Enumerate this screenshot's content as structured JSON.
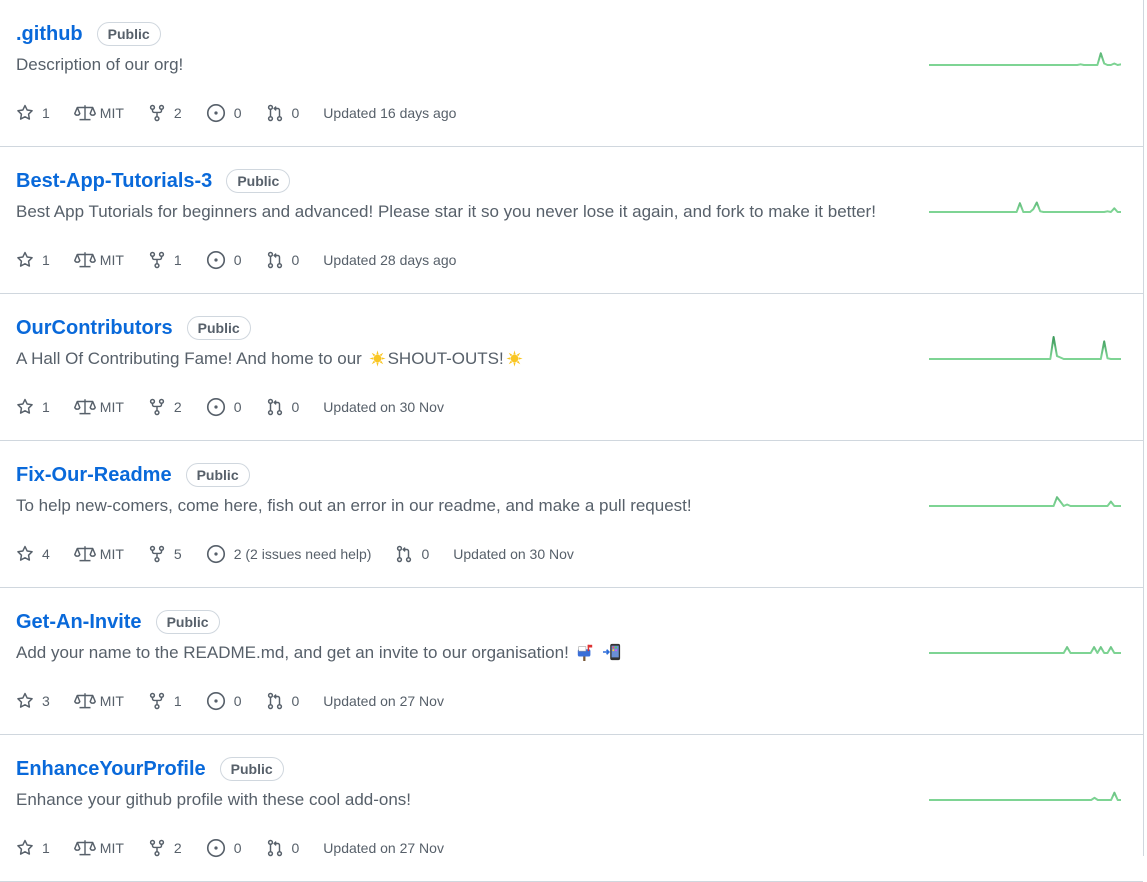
{
  "repos": [
    {
      "name": ".github",
      "visibility": "Public",
      "description": "Description of our org!",
      "stars": "1",
      "license": "MIT",
      "forks": "2",
      "issues": "0",
      "pulls": "0",
      "updated": "Updated 16 days ago",
      "activity": [
        0,
        0,
        0,
        0,
        0,
        0,
        0,
        0,
        0,
        0,
        0,
        0,
        0,
        0,
        0,
        0,
        0,
        0,
        0,
        0,
        0,
        0,
        0,
        0,
        0,
        0,
        0,
        0,
        0,
        0,
        0,
        0,
        0,
        0,
        0,
        0,
        0,
        0,
        0,
        0,
        0,
        0,
        0,
        0,
        0,
        1,
        0,
        0,
        0,
        0,
        0,
        16,
        2,
        0,
        0,
        2,
        0,
        1
      ]
    },
    {
      "name": "Best-App-Tutorials-3",
      "visibility": "Public",
      "description": "Best App Tutorials for beginners and advanced! Please star it so you never lose it again, and fork to make it better!",
      "stars": "1",
      "license": "MIT",
      "forks": "1",
      "issues": "0",
      "pulls": "0",
      "updated": "Updated 28 days ago",
      "activity": [
        0,
        0,
        0,
        0,
        0,
        0,
        0,
        0,
        0,
        0,
        0,
        0,
        0,
        0,
        0,
        0,
        0,
        0,
        0,
        0,
        0,
        0,
        0,
        0,
        0,
        0,
        0,
        12,
        0,
        0,
        0,
        4,
        13,
        1,
        0,
        0,
        0,
        0,
        0,
        0,
        0,
        0,
        0,
        0,
        0,
        0,
        0,
        0,
        0,
        0,
        0,
        0,
        0,
        1,
        0,
        5,
        0,
        0
      ]
    },
    {
      "name": "OurContributors",
      "visibility": "Public",
      "description": "A Hall Of Contributing Fame! And home to our 🌟SHOUT-OUTS!🌟",
      "stars": "1",
      "license": "MIT",
      "forks": "2",
      "issues": "0",
      "pulls": "0",
      "updated": "Updated on 30 Nov",
      "activity": [
        0,
        0,
        0,
        0,
        0,
        0,
        0,
        0,
        0,
        0,
        0,
        0,
        0,
        0,
        0,
        0,
        0,
        0,
        0,
        0,
        0,
        0,
        0,
        0,
        0,
        0,
        0,
        0,
        0,
        0,
        0,
        0,
        0,
        0,
        0,
        0,
        0,
        30,
        4,
        2,
        0,
        0,
        0,
        0,
        0,
        0,
        0,
        0,
        0,
        0,
        0,
        0,
        24,
        1,
        0,
        0,
        0,
        0
      ]
    },
    {
      "name": "Fix-Our-Readme",
      "visibility": "Public",
      "description": "To help new-comers, come here, fish out an error in our readme, and make a pull request!",
      "stars": "4",
      "license": "MIT",
      "forks": "5",
      "issues": "2 (2 issues need help)",
      "pulls": "0",
      "updated": "Updated on 30 Nov",
      "activity": [
        0,
        0,
        0,
        0,
        0,
        0,
        0,
        0,
        0,
        0,
        0,
        0,
        0,
        0,
        0,
        0,
        0,
        0,
        0,
        0,
        0,
        0,
        0,
        0,
        0,
        0,
        0,
        0,
        0,
        0,
        0,
        0,
        0,
        0,
        0,
        0,
        0,
        0,
        12,
        6,
        0,
        2,
        0,
        0,
        0,
        0,
        0,
        0,
        0,
        0,
        0,
        0,
        0,
        0,
        6,
        0,
        0,
        0
      ]
    },
    {
      "name": "Get-An-Invite",
      "visibility": "Public",
      "description": "Add your name to the README.md, and get an invite to our organisation! 📫 📲",
      "stars": "3",
      "license": "MIT",
      "forks": "1",
      "issues": "0",
      "pulls": "0",
      "updated": "Updated on 27 Nov",
      "activity": [
        0,
        0,
        0,
        0,
        0,
        0,
        0,
        0,
        0,
        0,
        0,
        0,
        0,
        0,
        0,
        0,
        0,
        0,
        0,
        0,
        0,
        0,
        0,
        0,
        0,
        0,
        0,
        0,
        0,
        0,
        0,
        0,
        0,
        0,
        0,
        0,
        0,
        0,
        0,
        0,
        0,
        8,
        0,
        0,
        0,
        0,
        0,
        0,
        0,
        8,
        0,
        8,
        0,
        0,
        8,
        0,
        0,
        0
      ]
    },
    {
      "name": "EnhanceYourProfile",
      "visibility": "Public",
      "description": "Enhance your github profile with these cool add-ons!",
      "stars": "1",
      "license": "MIT",
      "forks": "2",
      "issues": "0",
      "pulls": "0",
      "updated": "Updated on 27 Nov",
      "activity": [
        0,
        0,
        0,
        0,
        0,
        0,
        0,
        0,
        0,
        0,
        0,
        0,
        0,
        0,
        0,
        0,
        0,
        0,
        0,
        0,
        0,
        0,
        0,
        0,
        0,
        0,
        0,
        0,
        0,
        0,
        0,
        0,
        0,
        0,
        0,
        0,
        0,
        0,
        0,
        0,
        0,
        0,
        0,
        0,
        0,
        0,
        0,
        0,
        0,
        0,
        3,
        0,
        0,
        0,
        0,
        0,
        10,
        0,
        0
      ]
    }
  ],
  "colors": {
    "link": "#0969da",
    "sparkline": "#7ed494",
    "sparkline_peak": "#3c9a5b"
  }
}
